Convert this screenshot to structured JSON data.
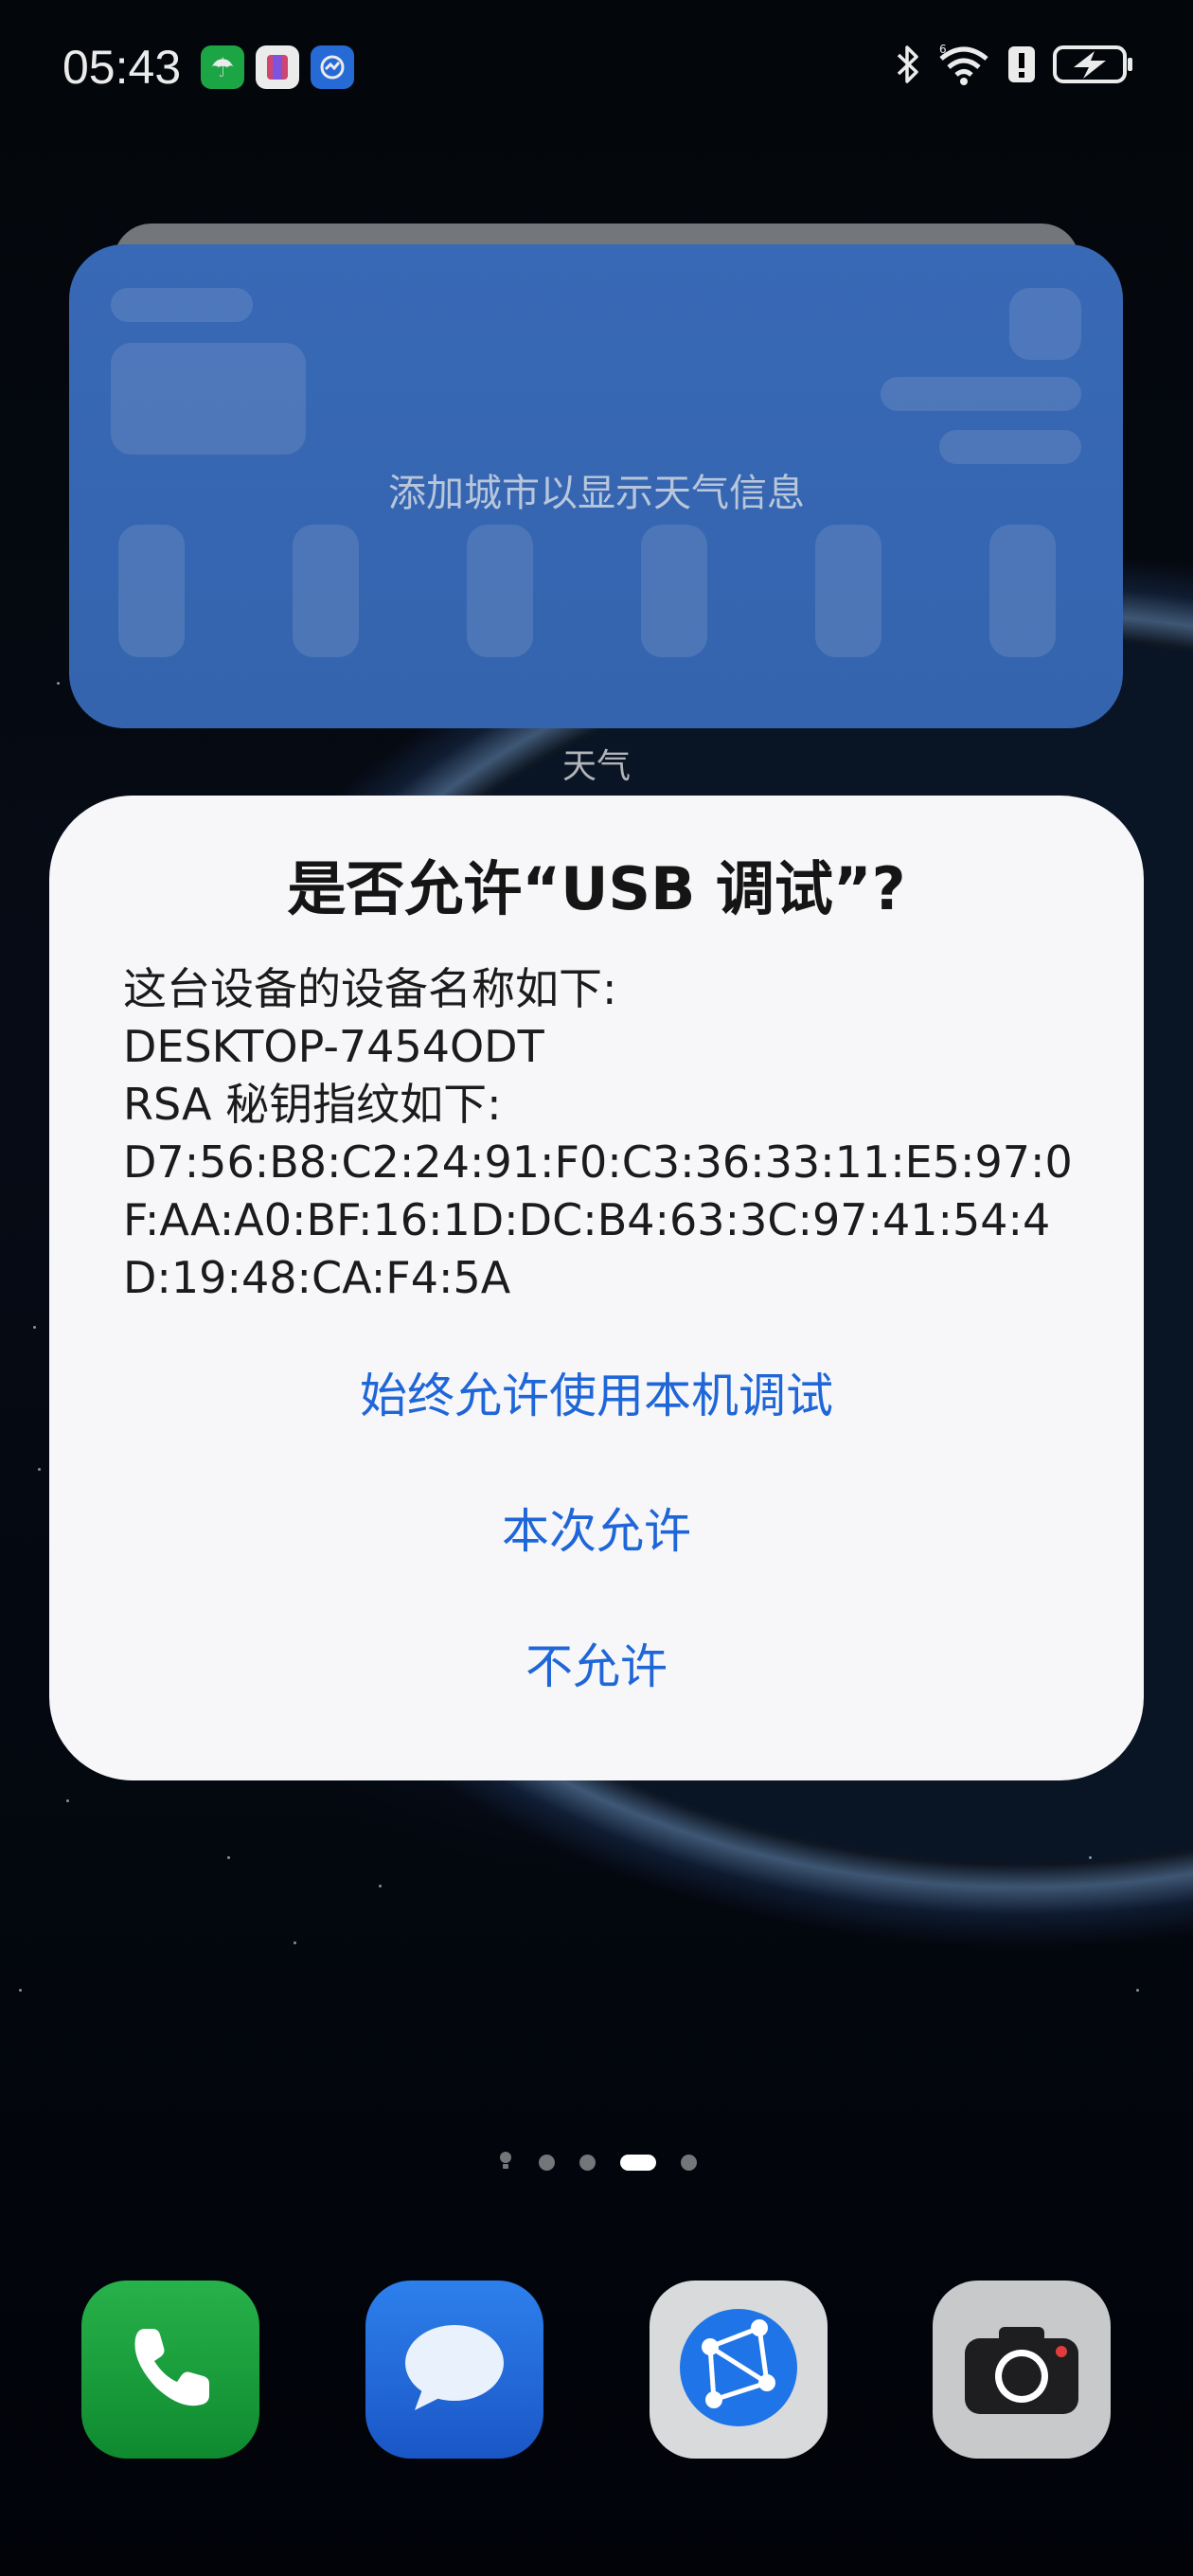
{
  "status_bar": {
    "time": "05:43",
    "app_icons": [
      "umbrella-app-icon",
      "bookmark-app-icon",
      "chart-app-icon"
    ],
    "right_icons": [
      "bluetooth-icon",
      "wifi-icon",
      "alert-icon",
      "battery-charging-icon"
    ]
  },
  "widget": {
    "message": "添加城市以显示天气信息",
    "label": "天气"
  },
  "dialog": {
    "title": "是否允许“USB 调试”?",
    "body_lines": [
      "这台设备的设备名称如下:",
      "DESKTOP-7454ODT",
      "RSA 秘钥指纹如下:",
      "D7:56:B8:C2:24:91:F0:C3:36:33:11:E5:97:0",
      "F:AA:A0:BF:16:1D:DC:B4:63:3C:97:41:54:4",
      "D:19:48:CA:F4:5A"
    ],
    "buttons": {
      "always_allow": "始终允许使用本机调试",
      "allow_once": "本次允许",
      "deny": "不允许"
    }
  },
  "pager": {
    "pages": 4,
    "active_index": 2
  },
  "dock": {
    "apps": [
      "phone-icon",
      "messages-icon",
      "browser-icon",
      "camera-icon"
    ]
  },
  "colors": {
    "accent": "#1f66d8",
    "widget_bg": "#3d72c6",
    "dialog_bg": "#f7f7f9"
  }
}
